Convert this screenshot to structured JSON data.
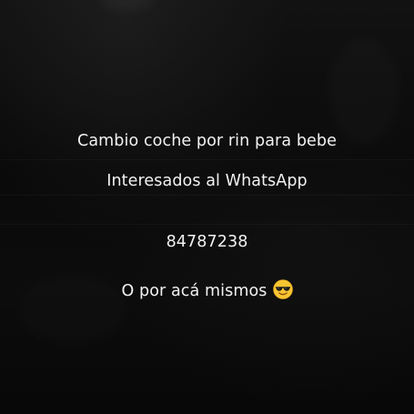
{
  "post": {
    "line1": "Cambio coche por rin para bebe",
    "line2": "Interesados al WhatsApp",
    "line3": "84787238",
    "line4": "O por acá mismos",
    "line4_emoji": "smiling-face-with-sunglasses-icon"
  },
  "colors": {
    "background": "#0b0b0b",
    "text": "#f2f2f2"
  }
}
